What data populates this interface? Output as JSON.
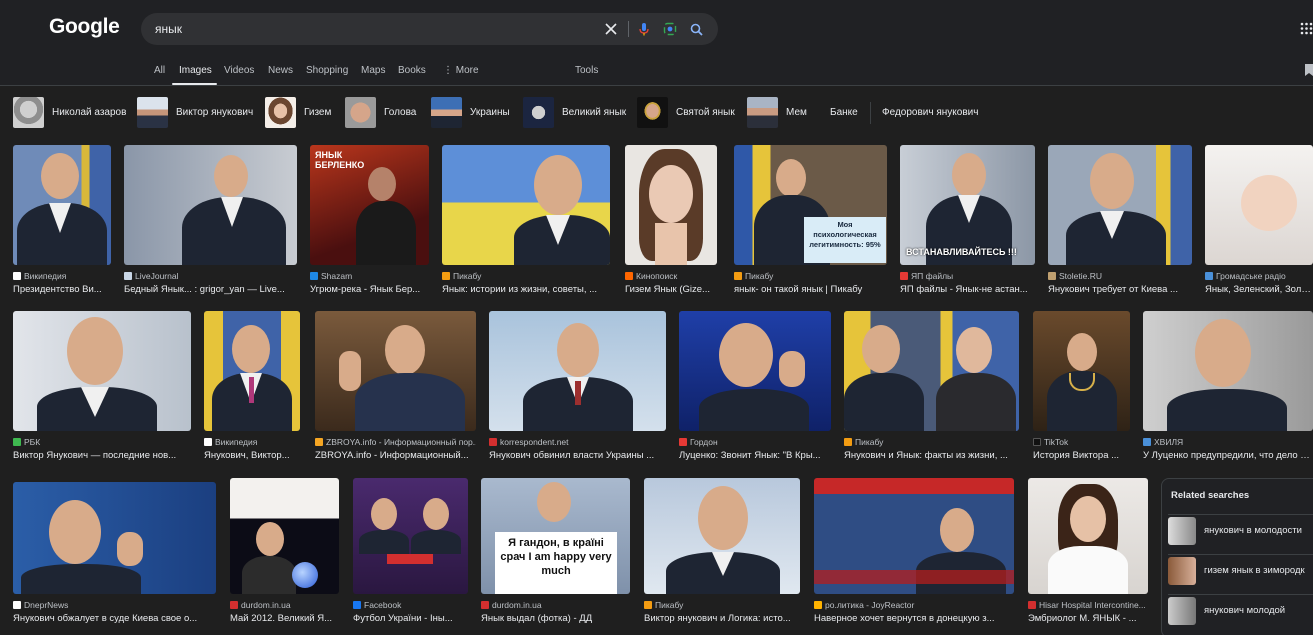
{
  "header": {
    "logo": "Google",
    "search_query": "янык",
    "tools_label": "Tools"
  },
  "tabs": [
    {
      "label": "All"
    },
    {
      "label": "Images"
    },
    {
      "label": "Videos"
    },
    {
      "label": "News"
    },
    {
      "label": "Shopping"
    },
    {
      "label": "Maps"
    },
    {
      "label": "Books"
    },
    {
      "label": "More"
    }
  ],
  "chips": [
    {
      "label": "Николай азаров"
    },
    {
      "label": "Виктор янукович"
    },
    {
      "label": "Гизем"
    },
    {
      "label": "Голова"
    },
    {
      "label": "Украины"
    },
    {
      "label": "Великий янык"
    },
    {
      "label": "Святой янык"
    },
    {
      "label": "Мем"
    },
    {
      "label": "Банке"
    },
    {
      "label": "Федорович янукович"
    }
  ],
  "results": [
    {
      "source": "Википедия",
      "title": "Президентство Ви..."
    },
    {
      "source": "LiveJournal",
      "title": "Бедный Янык... : grigor_yan — Live..."
    },
    {
      "source": "Shazam",
      "title": "Угрюм-река - Янык Бер...",
      "overlay": "ЯНЫК БЕРЛЕНКО"
    },
    {
      "source": "Пикабу",
      "title": "Янык: истории из жизни, советы, ..."
    },
    {
      "source": "Кинопоиск",
      "title": "Гизем Янык (Gize..."
    },
    {
      "source": "Пикабу",
      "title": "янык- он такой янык | Пикабу",
      "overlay": "Моя психологическая легитимность: 95%"
    },
    {
      "source": "ЯП файлы",
      "title": "ЯП файлы - Янык-не астан...",
      "overlay": "ВСТАНАВЛИВАЙТЕСЬ !!!"
    },
    {
      "source": "Stoletie.RU",
      "title": "Янукович требует от Киева ..."
    },
    {
      "source": "Громадське радіо",
      "title": "Янык, Зеленский, Золу..."
    },
    {
      "source": "РБК",
      "title": "Виктор Янукович — последние нов..."
    },
    {
      "source": "Википедия",
      "title": "Янукович, Виктор..."
    },
    {
      "source": "ZBROYA.info - Информационный пор...",
      "title": "ZBROYA.info - Информационный..."
    },
    {
      "source": "korrespondent.net",
      "title": "Янукович обвинил власти Украины ..."
    },
    {
      "source": "Гордон",
      "title": "Луценко: Звонит Янык: \"В Кры..."
    },
    {
      "source": "Пикабу",
      "title": "Янукович и Янык: факты из жизни, ..."
    },
    {
      "source": "TikTok",
      "title": "История Виктора ..."
    },
    {
      "source": "ХВИЛЯ",
      "title": "У Луценко предупредили, что дело о ..."
    },
    {
      "source": "DneprNews",
      "title": "Янукович обжалует в суде Киева свое о..."
    },
    {
      "source": "durdom.in.ua",
      "title": "Май 2012. Великий Я..."
    },
    {
      "source": "Facebook",
      "title": "Футбол України - Іны..."
    },
    {
      "source": "durdom.in.ua",
      "title": "Янык выдал (фотка) - ДД",
      "overlay": "Я гандон, в країні срач I am happy very much"
    },
    {
      "source": "Пикабу",
      "title": "Виктор янукович и Логика: исто..."
    },
    {
      "source": "po.литика - JoyReactor",
      "title": "Наверное хочет вернутся в донецкую з..."
    },
    {
      "source": "Hisar Hospital Intercontine...",
      "title": "Эмбриолог М. ЯНЫК - ..."
    }
  ],
  "related": {
    "title": "Related searches",
    "items": [
      {
        "label": "янукович в молодости"
      },
      {
        "label": "гизем янык в зимородк"
      },
      {
        "label": "янукович молодой"
      }
    ]
  },
  "colors": {
    "background": "#1f1f1f",
    "header": "#202124",
    "search_box": "#303134",
    "text": "#e8eaed"
  }
}
